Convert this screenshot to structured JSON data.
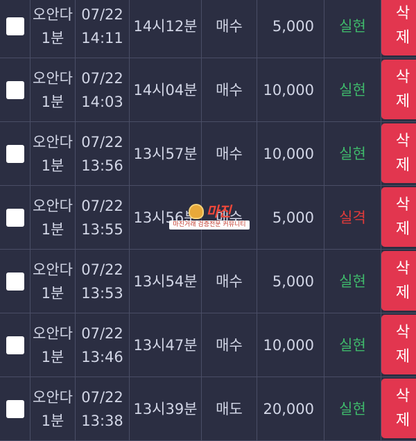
{
  "colors": {
    "background": "#2b2e42",
    "text": "#d2d6e6",
    "result_good": "#3fb96b",
    "result_bad": "#e03a3a",
    "delete_button": "#e2364f"
  },
  "delete_label_line1": "삭",
  "delete_label_line2": "제",
  "rows": [
    {
      "name1": "오안다",
      "name2": "1분",
      "date": "07/22",
      "time": "14:11",
      "minute": "14시12분",
      "type": "매수",
      "amount": "5,000",
      "result": "실현",
      "result_status": "good"
    },
    {
      "name1": "오안다",
      "name2": "1분",
      "date": "07/22",
      "time": "14:03",
      "minute": "14시04분",
      "type": "매수",
      "amount": "10,000",
      "result": "실현",
      "result_status": "good"
    },
    {
      "name1": "오안다",
      "name2": "1분",
      "date": "07/22",
      "time": "13:56",
      "minute": "13시57분",
      "type": "매수",
      "amount": "10,000",
      "result": "실현",
      "result_status": "good"
    },
    {
      "name1": "오안다",
      "name2": "1분",
      "date": "07/22",
      "time": "13:55",
      "minute": "13시56분",
      "type": "매수",
      "amount": "5,000",
      "result": "실격",
      "result_status": "bad"
    },
    {
      "name1": "오안다",
      "name2": "1분",
      "date": "07/22",
      "time": "13:53",
      "minute": "13시54분",
      "type": "매수",
      "amount": "5,000",
      "result": "실현",
      "result_status": "good"
    },
    {
      "name1": "오안다",
      "name2": "1분",
      "date": "07/22",
      "time": "13:46",
      "minute": "13시47분",
      "type": "매수",
      "amount": "10,000",
      "result": "실현",
      "result_status": "good"
    },
    {
      "name1": "오안다",
      "name2": "1분",
      "date": "07/22",
      "time": "13:38",
      "minute": "13시39분",
      "type": "매도",
      "amount": "20,000",
      "result": "실현",
      "result_status": "good"
    }
  ],
  "watermark": {
    "title": "마진",
    "subtitle": "마진거래 검증전문 커뮤니티",
    "icon": "eagle-badge-icon"
  }
}
